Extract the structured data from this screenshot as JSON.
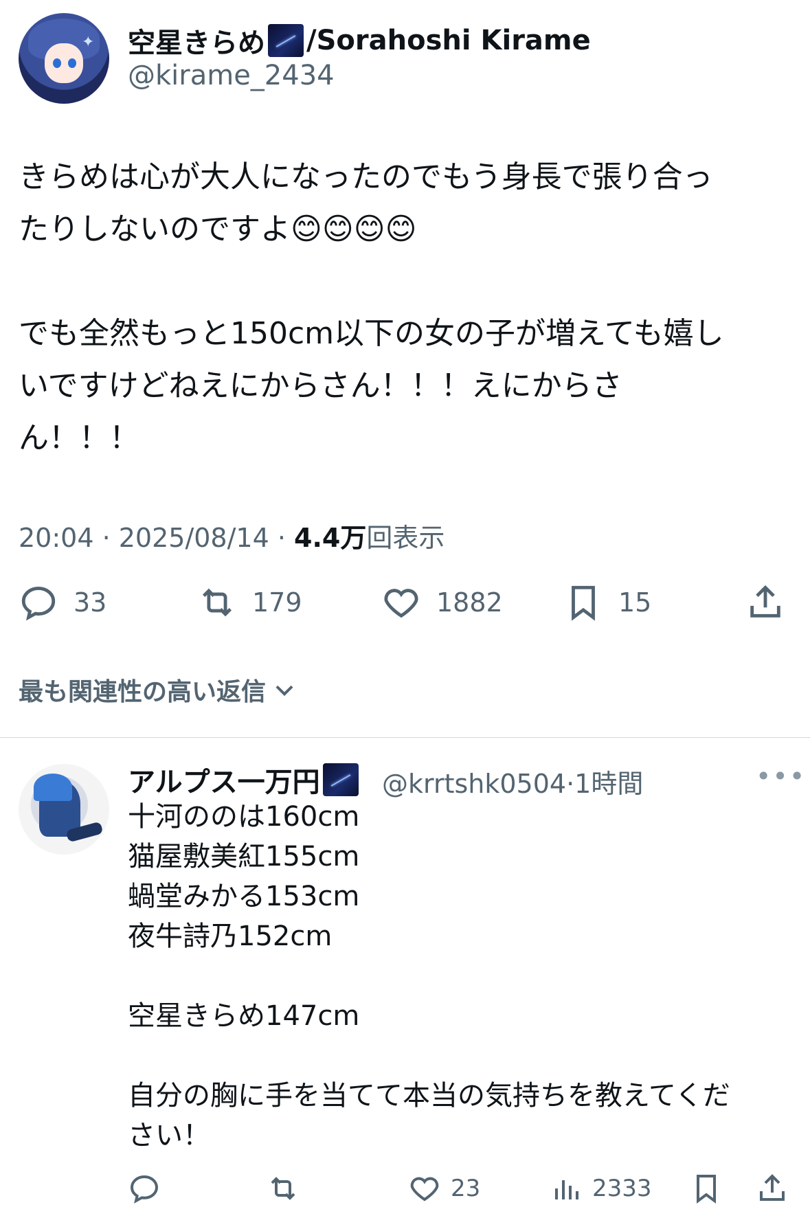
{
  "tweet": {
    "display_name": "空星きらめ",
    "display_name_suffix": "/Sorahoshi Kirame",
    "handle": "@kirame_2434",
    "text": "きらめは心が大人になったのでもう身長で張り合っ\nたりしないのですよ😊😊😊😊\n\nでも全然もっと150cm以下の女の子が増えても嬉し\nいですけどねえにからさん！！！えにからさ\nん！！！",
    "time": "20:04 · 2025/08/14 · ",
    "views_count": "4.4万",
    "views_label": "回表示",
    "replies": "33",
    "retweets": "179",
    "likes": "1882",
    "bookmarks": "15"
  },
  "sort": {
    "label": "最も関連性の高い返信"
  },
  "reply": {
    "display_name": "アルプス一万円",
    "handle": "@krrtshk0504",
    "time_ago": "·1時間",
    "more": "•••",
    "text": "十河ののは160cm\n猫屋敷美紅155cm\n蝸堂みかる153cm\n夜牛詩乃152cm\n\n空星きらめ147cm\n\n自分の胸に手を当てて本当の気持ちを教えてくだ\nさい！",
    "likes": "23",
    "views": "2333"
  },
  "colors": {
    "secondary_text": "#536471",
    "primary_text": "#0f1419",
    "divider": "#cfd9de"
  }
}
